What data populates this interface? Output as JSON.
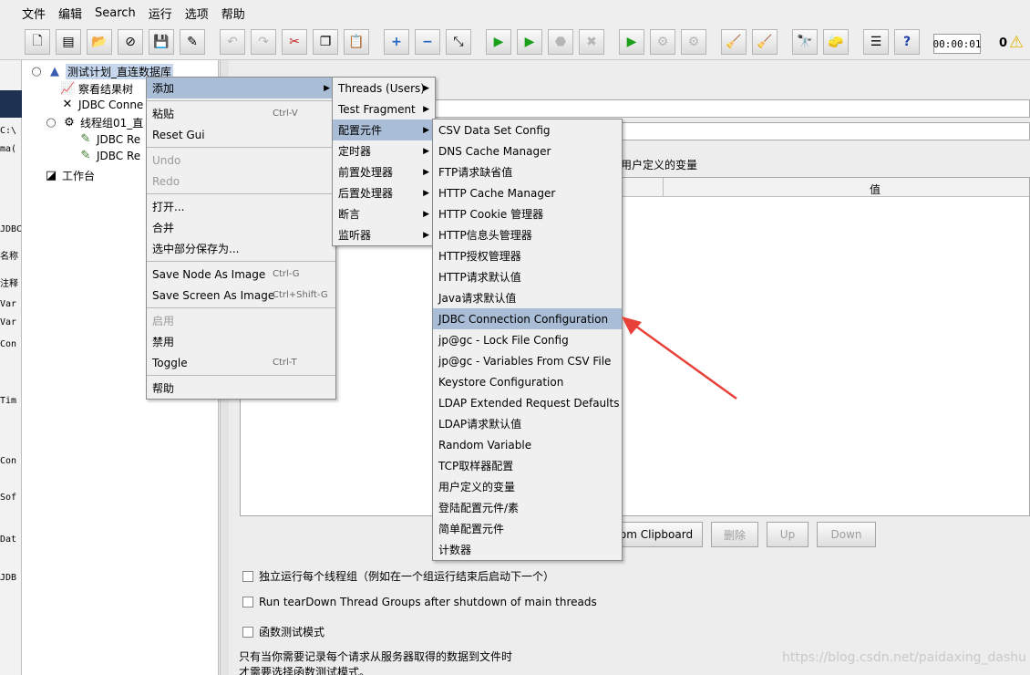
{
  "menubar": {
    "items": [
      "文件",
      "编辑",
      "Search",
      "运行",
      "选项",
      "帮助"
    ]
  },
  "toolbar": {
    "timer": "00:00:01",
    "error_count": "0"
  },
  "left_strip": [
    "C:\\",
    "ma(",
    "JDBC",
    "名称",
    "注释",
    "Var",
    "Var",
    "Con",
    "Tim",
    "Con",
    "Sof",
    "Dat",
    "JDB"
  ],
  "tree": {
    "nodes": [
      "测试计划_直连数据库",
      "察看结果树",
      "JDBC Conne",
      "线程组01_直",
      "JDBC Re",
      "JDBC Re",
      "工作台"
    ]
  },
  "right": {
    "section_label": "用户定义的变量",
    "table_value_header": "值",
    "buttons": {
      "clipboard": "om Clipboard",
      "delete": "删除",
      "up": "Up",
      "down": "Down"
    },
    "options": [
      "独立运行每个线程组（例如在一个组运行结束后启动下一个）",
      "Run tearDown Thread Groups after shutdown of main threads",
      "函数测试模式"
    ],
    "note_line1": "只有当你需要记录每个请求从服务器取得的数据到文件时",
    "note_line2": "才需要选择函数测试模式。"
  },
  "context_menu": {
    "items": [
      {
        "label": "添加",
        "shortcut": "",
        "submenu": true,
        "highlighted": true
      },
      {
        "label": "粘贴",
        "shortcut": "Ctrl-V"
      },
      {
        "label": "Reset Gui",
        "shortcut": ""
      },
      {
        "label": "Undo",
        "shortcut": "",
        "disabled": true
      },
      {
        "label": "Redo",
        "shortcut": "",
        "disabled": true
      },
      {
        "label": "打开...",
        "shortcut": ""
      },
      {
        "label": "合并",
        "shortcut": ""
      },
      {
        "label": "选中部分保存为...",
        "shortcut": ""
      },
      {
        "label": "Save Node As Image",
        "shortcut": "Ctrl-G"
      },
      {
        "label": "Save Screen As Image",
        "shortcut": "Ctrl+Shift-G"
      },
      {
        "label": "启用",
        "shortcut": "",
        "disabled": true
      },
      {
        "label": "禁用",
        "shortcut": ""
      },
      {
        "label": "Toggle",
        "shortcut": "Ctrl-T"
      },
      {
        "label": "帮助",
        "shortcut": ""
      }
    ]
  },
  "add_submenu": {
    "items": [
      "Threads (Users)",
      "Test Fragment",
      "配置元件",
      "定时器",
      "前置处理器",
      "后置处理器",
      "断言",
      "监听器"
    ]
  },
  "config_submenu": {
    "items": [
      "CSV Data Set Config",
      "DNS Cache Manager",
      "FTP请求缺省值",
      "HTTP Cache Manager",
      "HTTP Cookie 管理器",
      "HTTP信息头管理器",
      "HTTP授权管理器",
      "HTTP请求默认值",
      "Java请求默认值",
      "JDBC Connection Configuration",
      "jp@gc - Lock File Config",
      "jp@gc - Variables From CSV File",
      "Keystore Configuration",
      "LDAP Extended Request Defaults",
      "LDAP请求默认值",
      "Random Variable",
      "TCP取样器配置",
      "用户定义的变量",
      "登陆配置元件/素",
      "简单配置元件",
      "计数器"
    ]
  },
  "watermark": "https://blog.csdn.net/paidaxing_dashu",
  "colors": {
    "highlight": "#a9bdd6",
    "arrow": "#e8413a",
    "selection": "#c7d8ee"
  }
}
